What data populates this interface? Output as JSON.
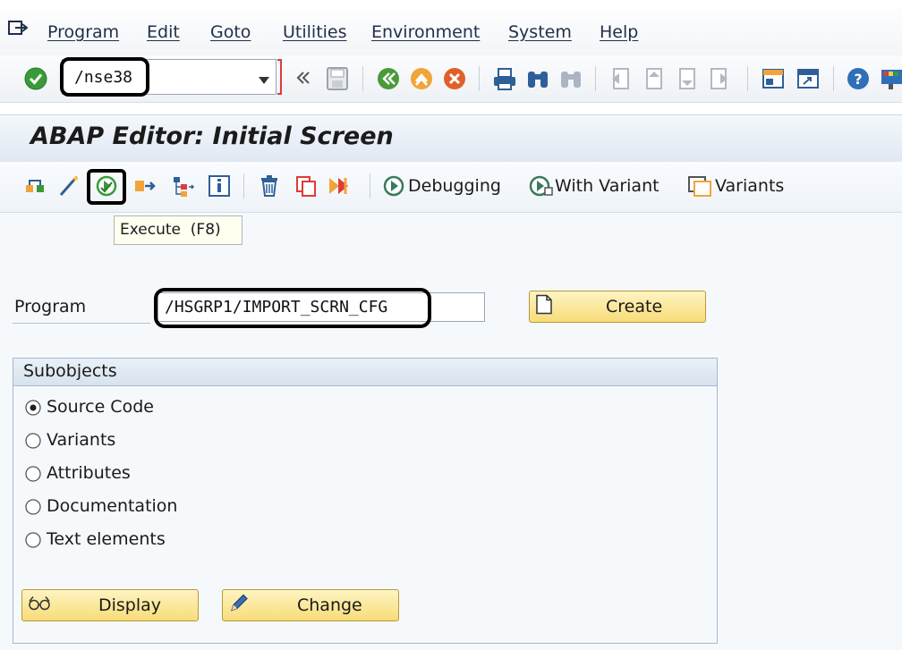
{
  "menu": {
    "items": [
      {
        "label": "Program"
      },
      {
        "label": "Edit"
      },
      {
        "label": "Goto"
      },
      {
        "label": "Utilities"
      },
      {
        "label": "Environment"
      },
      {
        "label": "System"
      },
      {
        "label": "Help"
      }
    ]
  },
  "toolbar": {
    "command_value": "/nse38"
  },
  "screen": {
    "title": "ABAP Editor: Initial Screen"
  },
  "app_toolbar": {
    "debugging_label": "Debugging",
    "with_variant_label": "With Variant",
    "variants_label": "Variants",
    "tooltip": "Execute  (F8)"
  },
  "form": {
    "program_label": "Program",
    "program_value": "/HSGRP1/IMPORT_SCRN_CFG",
    "create_label": "Create"
  },
  "subobjects": {
    "title": "Subobjects",
    "options": [
      {
        "label": "Source Code",
        "selected": true
      },
      {
        "label": "Variants",
        "selected": false
      },
      {
        "label": "Attributes",
        "selected": false
      },
      {
        "label": "Documentation",
        "selected": false
      },
      {
        "label": "Text elements",
        "selected": false
      }
    ],
    "display_label": "Display",
    "change_label": "Change"
  },
  "colors": {
    "button_fill": "#f7dc78",
    "enter_green": "#3a9a3a",
    "highlight": "#000000"
  }
}
